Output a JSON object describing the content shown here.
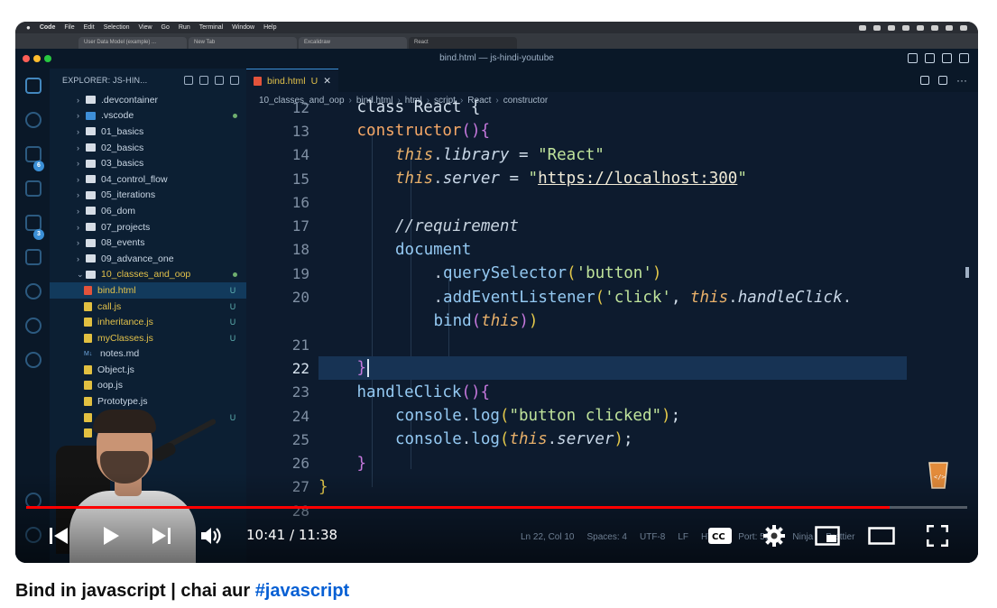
{
  "mac_menubar": {
    "items": [
      "Code",
      "File",
      "Edit",
      "Selection",
      "View",
      "Go",
      "Run",
      "Terminal",
      "Window",
      "Help"
    ]
  },
  "browser_tabs": [
    "User Data Model (example) ...",
    "New Tab",
    "Excalidraw",
    "React"
  ],
  "vscode": {
    "window_title": "bind.html — js-hindi-youtube",
    "explorer_title": "EXPLORER: JS-HIN...",
    "tree": [
      {
        "label": ".devcontainer",
        "kind": "folder"
      },
      {
        "label": ".vscode",
        "kind": "folder vscode",
        "dot": true
      },
      {
        "label": "01_basics",
        "kind": "folder"
      },
      {
        "label": "02_basics",
        "kind": "folder"
      },
      {
        "label": "03_basics",
        "kind": "folder"
      },
      {
        "label": "04_control_flow",
        "kind": "folder"
      },
      {
        "label": "05_iterations",
        "kind": "folder"
      },
      {
        "label": "06_dom",
        "kind": "folder"
      },
      {
        "label": "07_projects",
        "kind": "folder"
      },
      {
        "label": "08_events",
        "kind": "folder"
      },
      {
        "label": "09_advance_one",
        "kind": "folder"
      },
      {
        "label": "10_classes_and_oop",
        "kind": "folder open",
        "dot": true,
        "mod": true
      },
      {
        "label": "bind.html",
        "kind": "file html",
        "status": "U",
        "selected": true,
        "mod": true
      },
      {
        "label": "call.js",
        "kind": "file",
        "status": "U",
        "mod": true
      },
      {
        "label": "inheritance.js",
        "kind": "file",
        "status": "U",
        "mod": true
      },
      {
        "label": "myClasses.js",
        "kind": "file",
        "status": "U",
        "mod": true
      },
      {
        "label": "notes.md",
        "kind": "file md"
      },
      {
        "label": "Object.js",
        "kind": "file"
      },
      {
        "label": "oop.js",
        "kind": "file"
      },
      {
        "label": "Prototype.js",
        "kind": "file"
      },
      {
        "label": "op.js",
        "kind": "file",
        "status": "U",
        "mod": true
      },
      {
        "label": "nd",
        "kind": "file"
      }
    ],
    "editor_tab": {
      "label": "bind.html",
      "status": "U",
      "close": "✕"
    },
    "breadcrumb": [
      "10_classes_and_oop",
      "bind.html",
      "html",
      "script",
      "React",
      "constructor"
    ],
    "code_lines": [
      {
        "n": "12",
        "html": "<span class='plain'>class React {</span>",
        "indent": 2
      },
      {
        "n": "13",
        "html": "<span class='fn'>constructor</span><span class='brace2'>()</span><span class='brace2'>{</span>",
        "indent": 2
      },
      {
        "n": "14",
        "html": "<span class='kw-this'>this</span><span class='punc'>.</span><span class='prop'>library</span><span class='plain'> = </span><span class='str'>\"React\"</span>",
        "indent": 3
      },
      {
        "n": "15",
        "html": "<span class='kw-this'>this</span><span class='punc'>.</span><span class='prop'>server</span><span class='plain'> = </span><span class='str'>\"</span><span class='strpat'>https://localhost:300</span><span class='str'>\"</span>",
        "indent": 3
      },
      {
        "n": "16",
        "html": "",
        "indent": 3
      },
      {
        "n": "17",
        "html": "<span class='comment'>//requirement</span>",
        "indent": 3
      },
      {
        "n": "18",
        "html": "<span class='fn2'>document</span>",
        "indent": 3
      },
      {
        "n": "19",
        "html": "<span class='punc'>.</span><span class='fn2'>querySelector</span><span class='brace'>(</span><span class='str'>'button'</span><span class='brace'>)</span>",
        "indent": 4
      },
      {
        "n": "20",
        "html": "<span class='punc'>.</span><span class='fn2'>addEventListener</span><span class='brace'>(</span><span class='str'>'click'</span><span class='plain'>, </span><span class='kw-this'>this</span><span class='punc'>.</span><span class='prop'>handleClick</span><span class='punc'>.</span>",
        "indent": 4
      },
      {
        "n": "",
        "html": "<span class='fn2'>bind</span><span class='brace2'>(</span><span class='kw-this'>this</span><span class='brace2'>)</span><span class='brace'>)</span>",
        "indent": 4
      },
      {
        "n": "21",
        "html": "",
        "indent": 3
      },
      {
        "n": "22",
        "html": "<span class='brace2'>}</span>",
        "indent": 2,
        "current": true
      },
      {
        "n": "23",
        "html": "<span class='fn2'>handleClick</span><span class='brace2'>()</span><span class='brace2'>{</span>",
        "indent": 2
      },
      {
        "n": "24",
        "html": "<span class='fn2'>console</span><span class='punc'>.</span><span class='fn2'>log</span><span class='brace'>(</span><span class='str'>\"button clicked\"</span><span class='brace'>)</span><span class='plain'>;</span>",
        "indent": 3
      },
      {
        "n": "25",
        "html": "<span class='fn2'>console</span><span class='punc'>.</span><span class='fn2'>log</span><span class='brace'>(</span><span class='kw-this'>this</span><span class='punc'>.</span><span class='prop'>server</span><span class='brace'>)</span><span class='plain'>;</span>",
        "indent": 3
      },
      {
        "n": "26",
        "html": "<span class='brace2'>}</span>",
        "indent": 2
      },
      {
        "n": "27",
        "html": "<span class='brace'>}</span>",
        "indent": 1
      },
      {
        "n": "28",
        "html": "",
        "indent": 1
      }
    ],
    "status_ghost": [
      "Ln 22, Col 10",
      "Spaces: 4",
      "UTF-8",
      "LF",
      "HTML",
      "Port: 5500",
      "Ninja",
      "Prettier"
    ]
  },
  "player": {
    "time_display": "10:41 / 11:38",
    "progress_fraction": 0.918,
    "accent": "#ff0000"
  },
  "video_title": {
    "text": "Bind in javascript | chai aur ",
    "hashtag": "#javascript"
  }
}
